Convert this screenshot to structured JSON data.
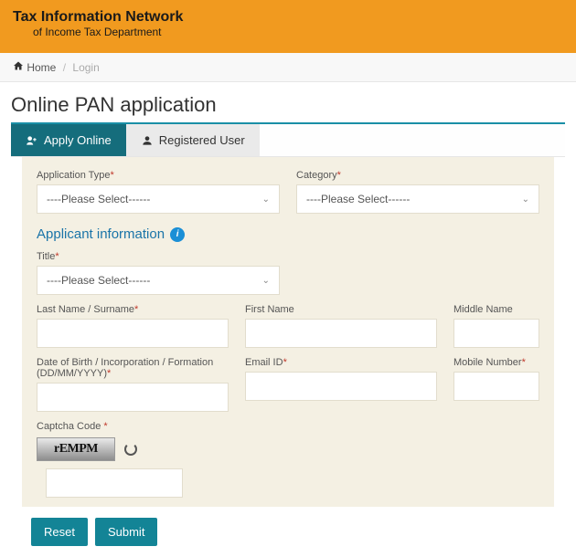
{
  "header": {
    "title": "Tax Information Network",
    "subtitle": "of Income Tax Department"
  },
  "breadcrumb": {
    "home": "Home",
    "login": "Login"
  },
  "page": {
    "title": "Online PAN application"
  },
  "tabs": {
    "apply": "Apply Online",
    "registered": "Registered User"
  },
  "form": {
    "appType": {
      "label": "Application Type",
      "value": "----Please Select------"
    },
    "category": {
      "label": "Category",
      "value": "----Please Select------"
    },
    "sectionHead": "Applicant information",
    "title": {
      "label": "Title",
      "value": "----Please Select------"
    },
    "lastName": {
      "label": "Last Name / Surname"
    },
    "firstName": {
      "label": "First Name"
    },
    "middleName": {
      "label": "Middle Name"
    },
    "dob": {
      "label": "Date of Birth / Incorporation / Formation (DD/MM/YYYY)"
    },
    "email": {
      "label": "Email ID"
    },
    "mobile": {
      "label": "Mobile Number"
    },
    "captcha": {
      "label": "Captcha Code",
      "sample": "rEMPM"
    },
    "reset": "Reset",
    "submit": "Submit"
  }
}
